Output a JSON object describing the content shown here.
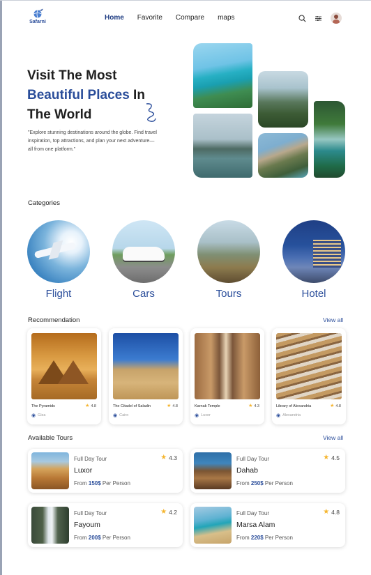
{
  "brand": {
    "name": "Safarni"
  },
  "nav": {
    "items": [
      "Home",
      "Favorite",
      "Compare",
      "maps"
    ],
    "active": "Home"
  },
  "header_icons": [
    "search-icon",
    "filter-icon",
    "user-avatar"
  ],
  "hero": {
    "title_line1": "Visit The Most",
    "title_accent": "Beautiful Places",
    "title_in": " In",
    "title_line3": "The World",
    "description": "\"Explore stunning destinations around the globe. Find travel inspiration, top attractions, and plan your next adventure—all from one platform.\""
  },
  "categories": {
    "title": "Categories",
    "items": [
      {
        "label": "Flight"
      },
      {
        "label": "Cars"
      },
      {
        "label": "Tours"
      },
      {
        "label": "Hotel"
      }
    ]
  },
  "recommendation": {
    "title": "Recommendation",
    "view_all": "View all",
    "items": [
      {
        "name": "The Pyramids",
        "rating": "4.8",
        "location": "Giza"
      },
      {
        "name": "The Citadel of Saladin",
        "rating": "4.8",
        "location": "Cairo"
      },
      {
        "name": "Karnak Temple",
        "rating": "4.3",
        "location": "Luxor"
      },
      {
        "name": "Library of Alexandria",
        "rating": "4.8",
        "location": "Alexandria"
      }
    ]
  },
  "tours": {
    "title": "Available Tours",
    "view_all": "View all",
    "items": [
      {
        "type": "Full Day Tour",
        "name": "Luxor",
        "price_prefix": "From ",
        "price": "150$",
        "price_suffix": " Per Person",
        "rating": "4.3"
      },
      {
        "type": "Full Day Tour",
        "name": "Dahab",
        "price_prefix": "From ",
        "price": "250$",
        "price_suffix": " Per Person",
        "rating": "4.5"
      },
      {
        "type": "Full Day Tour",
        "name": "Fayoum",
        "price_prefix": "From ",
        "price": "200$",
        "price_suffix": " Per Person",
        "rating": "4.2"
      },
      {
        "type": "Full Day Tour",
        "name": "Marsa Alam",
        "price_prefix": "From ",
        "price": "220$",
        "price_suffix": " Per Person",
        "rating": "4.8"
      }
    ]
  },
  "colors": {
    "accent": "#2a4d9a",
    "star": "#f5b52e"
  }
}
